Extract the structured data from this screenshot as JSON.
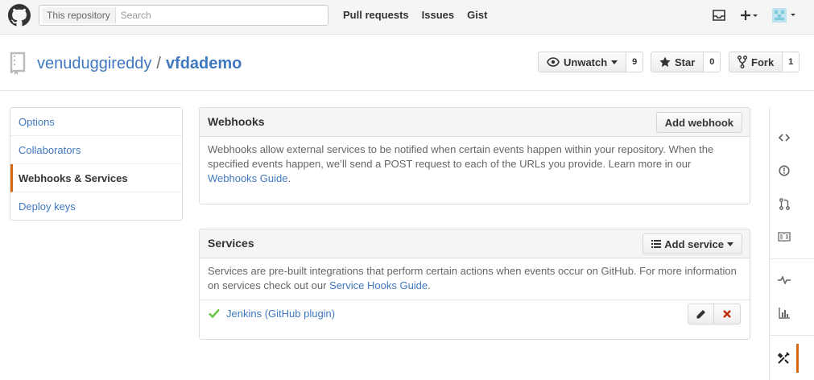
{
  "header": {
    "search_scope": "This repository",
    "search_placeholder": "Search",
    "nav": [
      "Pull requests",
      "Issues",
      "Gist"
    ],
    "icons": [
      "github-logo",
      "inbox-icon",
      "plus-icon",
      "avatar"
    ]
  },
  "repo": {
    "owner": "venuduggireddy",
    "separator": "/",
    "name": "vfdademo",
    "watch_label": "Unwatch",
    "watch_count": "9",
    "star_label": "Star",
    "star_count": "0",
    "fork_label": "Fork",
    "fork_count": "1"
  },
  "settings_menu": [
    {
      "label": "Options",
      "selected": false
    },
    {
      "label": "Collaborators",
      "selected": false
    },
    {
      "label": "Webhooks & Services",
      "selected": true
    },
    {
      "label": "Deploy keys",
      "selected": false
    }
  ],
  "webhooks": {
    "title": "Webhooks",
    "add_button": "Add webhook",
    "description": "Webhooks allow external services to be notified when certain events happen within your repository. When the specified events happen, we’ll send a POST request to each of the URLs you provide. Learn more in our ",
    "link": "Webhooks Guide",
    "end": "."
  },
  "services": {
    "title": "Services",
    "add_button": "Add service",
    "description": "Services are pre-built integrations that perform certain actions when events occur on GitHub. For more information on services check out our ",
    "link": "Service Hooks Guide",
    "end": ".",
    "items": [
      {
        "name": "Jenkins (GitHub plugin)",
        "status": "active"
      }
    ]
  },
  "repo_nav": [
    "code-icon",
    "issues-icon",
    "pull-request-icon",
    "wiki-icon",
    "pulse-icon",
    "graphs-icon",
    "settings-icon"
  ],
  "colors": {
    "link": "#4078c0",
    "selected_accent": "#d26911",
    "check": "#6cc644",
    "delete": "#bd2c00"
  }
}
